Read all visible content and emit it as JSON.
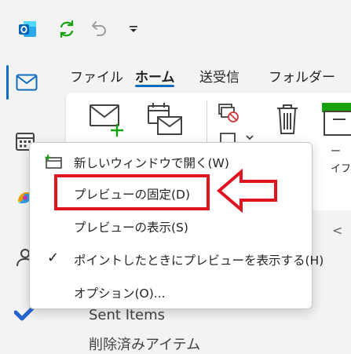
{
  "titlebar": {
    "outlook_icon": "outlook-logo-icon",
    "sync_icon": "sync-icon",
    "undo_icon": "undo-icon",
    "qat_icon": "chevron-down-icon"
  },
  "nav": {
    "items": [
      {
        "icon": "mail-icon"
      },
      {
        "icon": "calendar-icon"
      },
      {
        "icon": "copilot-icon"
      },
      {
        "icon": "people-icon"
      },
      {
        "icon": "todo-icon"
      }
    ]
  },
  "tabs": [
    "ファイル",
    "ホーム",
    "送受信",
    "フォルダー"
  ],
  "ribbon": {
    "new_mail_icon": "new-mail-icon",
    "new_items_icon": "new-items-icon",
    "ignore_icon": "ignore-icon",
    "delete_icon": "delete-icon",
    "archive_icon": "archive-icon",
    "frag1": "ー",
    "frag2": "イフ"
  },
  "folders": {
    "items": [
      "Sent Items",
      "削除済みアイテム"
    ]
  },
  "context_menu": {
    "items": [
      {
        "label": "新しいウィンドウで開く(W)",
        "icon": "new-window-icon"
      },
      {
        "label": "プレビューの固定(D)"
      },
      {
        "label": "プレビューの表示(S)"
      },
      {
        "label": "ポイントしたときにプレビューを表示する(H)",
        "checked": true
      },
      {
        "label": "オプション(O)..."
      }
    ]
  },
  "colors": {
    "accent": "#0f6cbd",
    "annotation": "#e0141e",
    "sync_green": "#13a10e"
  }
}
